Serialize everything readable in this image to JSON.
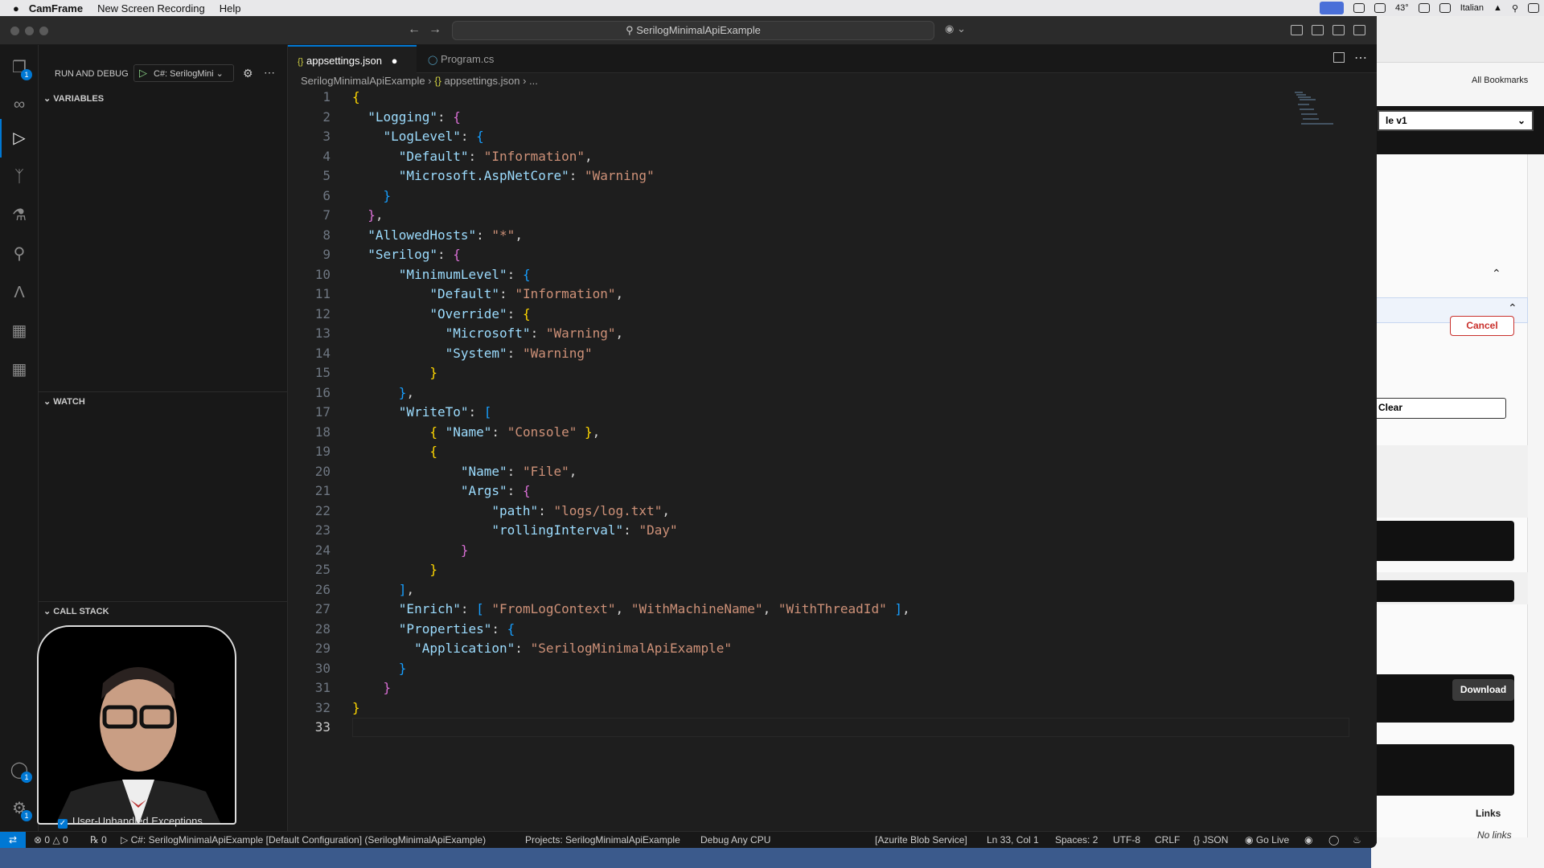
{
  "menubar": {
    "app": "CamFrame",
    "items": [
      "New Screen Recording",
      "Help"
    ],
    "tray": {
      "temp": "43°",
      "keyboard": "Italian"
    }
  },
  "browser": {
    "all_bookmarks": "All Bookmarks",
    "select_value": "le v1",
    "cancel": "Cancel",
    "clear": "Clear",
    "download": "Download",
    "links": "Links",
    "no_links": "No links"
  },
  "window": {
    "search": "SerilogMinimalApiExample"
  },
  "sidebar": {
    "title": "RUN AND DEBUG",
    "config": "C#: SerilogMini",
    "variables": "VARIABLES",
    "watch": "WATCH",
    "callstack": "CALL STACK",
    "exceptions_label": "User-Unhandled Exceptions"
  },
  "activity": {
    "explorer_badge": "1",
    "accounts_badge": "1",
    "settings_badge": "1"
  },
  "tabs": [
    {
      "label": "appsettings.json",
      "modified": "●"
    },
    {
      "label": "Program.cs"
    }
  ],
  "breadcrumb": {
    "folder": "SerilogMinimalApiExample",
    "file": "appsettings.json",
    "more": "..."
  },
  "editor": {
    "lines": [
      "{",
      "  \"Logging\": {",
      "    \"LogLevel\": {",
      "      \"Default\": \"Information\",",
      "      \"Microsoft.AspNetCore\": \"Warning\"",
      "    }",
      "  },",
      "  \"AllowedHosts\": \"*\",",
      "  \"Serilog\": {",
      "      \"MinimumLevel\": {",
      "          \"Default\": \"Information\",",
      "          \"Override\": {",
      "            \"Microsoft\": \"Warning\",",
      "            \"System\": \"Warning\"",
      "          }",
      "      },",
      "      \"WriteTo\": [",
      "          { \"Name\": \"Console\" },",
      "          {",
      "              \"Name\": \"File\",",
      "              \"Args\": {",
      "                  \"path\": \"logs/log.txt\",",
      "                  \"rollingInterval\": \"Day\"",
      "              }",
      "          }",
      "      ],",
      "      \"Enrich\": [ \"FromLogContext\", \"WithMachineName\", \"WithThreadId\" ],",
      "      \"Properties\": {",
      "        \"Application\": \"SerilogMinimalApiExample\"",
      "      }",
      "    }",
      "}",
      ""
    ],
    "current_line": 33
  },
  "status": {
    "errors": "0",
    "warnings": "0",
    "ports": "0",
    "debug_config": "C#: SerilogMinimalApiExample [Default Configuration] (SerilogMinimalApiExample)",
    "projects": "Projects: SerilogMinimalApiExample",
    "debug_cpu": "Debug Any CPU",
    "azurite": "[Azurite Blob Service]",
    "position": "Ln 33, Col 1",
    "spaces": "Spaces: 2",
    "encoding": "UTF-8",
    "eol": "CRLF",
    "language": "JSON",
    "golive": "Go Live"
  }
}
